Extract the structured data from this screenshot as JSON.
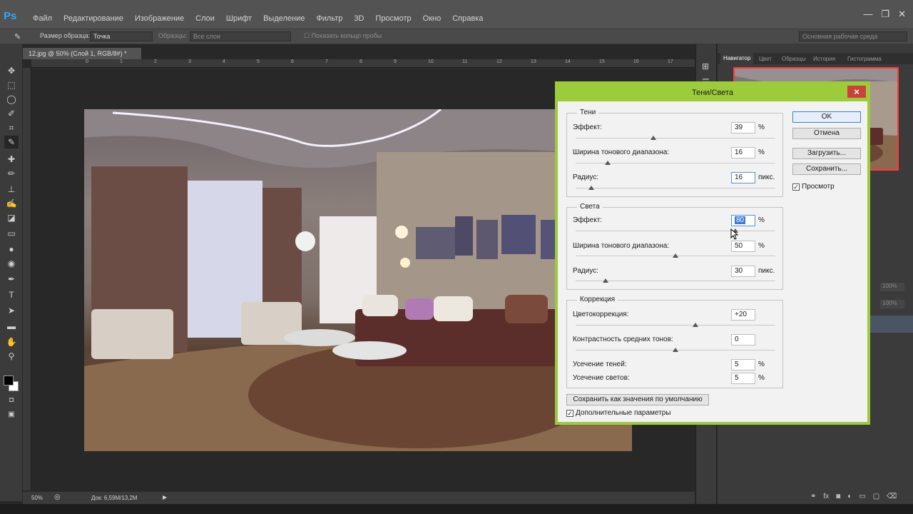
{
  "app": {
    "logo": "Ps"
  },
  "menu": [
    "Файл",
    "Редактирование",
    "Изображение",
    "Слои",
    "Шрифт",
    "Выделение",
    "Фильтр",
    "3D",
    "Просмотр",
    "Окно",
    "Справка"
  ],
  "window_controls": {
    "minimize": "—",
    "restore": "❐",
    "close": "✕"
  },
  "options": {
    "sample_size_label": "Размер образца:",
    "sample_size_value": "Точка",
    "samples_label": "Образцы:",
    "samples_value": "Все слои",
    "show_ring": "Показать кольцо пробы",
    "workspace": "Основная рабочая среда"
  },
  "document": {
    "tab_title": "12.jpg @ 50% (Слой 1, RGB/8#) *",
    "tab_close": "×",
    "ruler_ticks": [
      "0",
      "1",
      "2",
      "3",
      "4",
      "5",
      "6",
      "7",
      "8",
      "9",
      "10",
      "11",
      "12",
      "13",
      "14",
      "15",
      "16",
      "17"
    ],
    "status_zoom": "50%",
    "status_doc": "Док: 6,59M/13,2M"
  },
  "panel": {
    "tabs": [
      "Навигатор",
      "Цвет",
      "Образцы",
      "История",
      "Гистограмма"
    ],
    "layer_opacity": "100%",
    "layer_fill": "100%"
  },
  "dialog": {
    "title": "Тени/Света",
    "close": "×",
    "shadows": {
      "legend": "Тени",
      "effect_label": "Эффект:",
      "effect_value": "39",
      "effect_unit": "%",
      "effect_level": 39,
      "tonal_label": "Ширина тонового диапазона:",
      "tonal_value": "16",
      "tonal_unit": "%",
      "tonal_level": 16,
      "radius_label": "Радиус:",
      "radius_value": "16",
      "radius_unit": "пикс.",
      "radius_level": 8
    },
    "highlights": {
      "legend": "Света",
      "effect_label": "Эффект:",
      "effect_value": "80",
      "effect_unit": "%",
      "effect_level": 80,
      "tonal_label": "Ширина тонового диапазона:",
      "tonal_value": "50",
      "tonal_unit": "%",
      "tonal_level": 50,
      "radius_label": "Радиус:",
      "radius_value": "30",
      "radius_unit": "пикс.",
      "radius_level": 15
    },
    "correction": {
      "legend": "Коррекция",
      "color_label": "Цветокоррекция:",
      "color_value": "+20",
      "color_level": 60,
      "midtone_label": "Контрастность средних тонов:",
      "midtone_value": "0",
      "midtone_level": 50,
      "clip_shadows_label": "Усечение теней:",
      "clip_shadows_value": "5",
      "clip_shadows_unit": "%",
      "clip_highlights_label": "Усечение светов:",
      "clip_highlights_value": "5",
      "clip_highlights_unit": "%"
    },
    "buttons": {
      "ok": "OK",
      "cancel": "Отмена",
      "load": "Загрузить...",
      "save": "Сохранить..."
    },
    "preview_label": "Просмотр",
    "save_defaults": "Сохранить как значения по умолчанию",
    "more_options": "Дополнительные параметры",
    "checkmark": "✓"
  },
  "colors": {
    "dialog_frame": "#9ccc3c",
    "close_button": "#c8433a",
    "ps_blue": "#31a8ff"
  }
}
